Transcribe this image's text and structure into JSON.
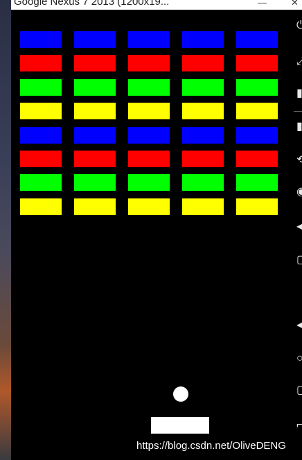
{
  "window": {
    "title": "Google Nexus 7 2013 (1200x19..."
  },
  "game": {
    "background": "#000000",
    "brick_colors": {
      "blue": "#0000ff",
      "red": "#ff0000",
      "green": "#00ff00",
      "yellow": "#ffff00"
    },
    "brick_rows": [
      "blue",
      "red",
      "green",
      "yellow",
      "blue",
      "red",
      "green",
      "yellow"
    ],
    "bricks_per_row": 5,
    "ball_color": "#ffffff",
    "paddle_color": "#ffffff"
  },
  "toolbar": {
    "icons": [
      "power-icon",
      "rotate-icon",
      "volume-up-icon",
      "volume-down-icon",
      "rotate-left-icon",
      "rotate-right-icon",
      "camera-icon",
      "zoom-icon",
      "back-icon",
      "home-icon",
      "overview-icon",
      "more-icon"
    ]
  },
  "watermark": {
    "text": "https://blog.csdn.net/OliveDENG"
  }
}
